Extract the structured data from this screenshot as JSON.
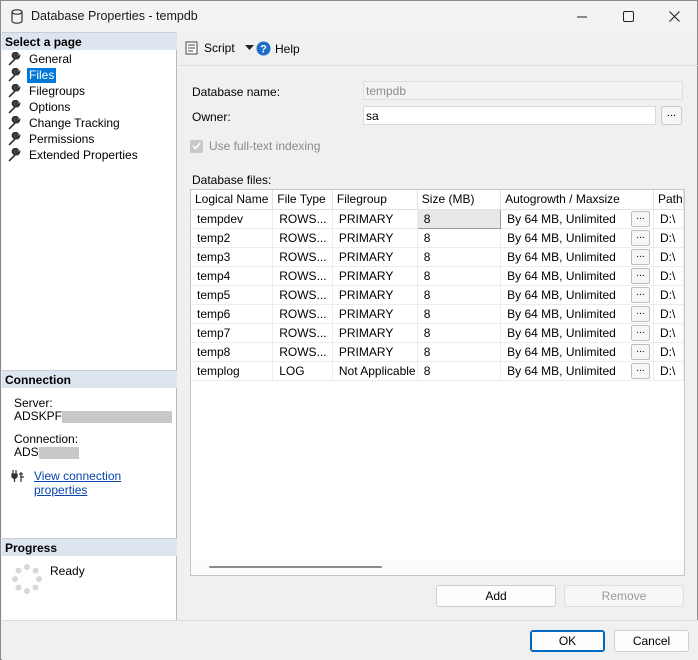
{
  "window": {
    "title": "Database Properties - tempdb"
  },
  "left_panel": {
    "select_page_header": "Select a page",
    "pages": [
      {
        "label": "General",
        "selected": false
      },
      {
        "label": "Files",
        "selected": true
      },
      {
        "label": "Filegroups",
        "selected": false
      },
      {
        "label": "Options",
        "selected": false
      },
      {
        "label": "Change Tracking",
        "selected": false
      },
      {
        "label": "Permissions",
        "selected": false
      },
      {
        "label": "Extended Properties",
        "selected": false
      }
    ],
    "connection_header": "Connection",
    "server_label": "Server:",
    "server_value": "ADSKPF",
    "connection_label": "Connection:",
    "connection_value": "ADS",
    "view_connection_link": "View connection properties",
    "progress_header": "Progress",
    "progress_status": "Ready"
  },
  "toolbar": {
    "script_label": "Script",
    "help_label": "Help"
  },
  "form": {
    "database_name_label": "Database name:",
    "database_name_value": "tempdb",
    "owner_label": "Owner:",
    "owner_value": "sa",
    "ellipsis": "...",
    "fulltext_label": "Use full-text indexing",
    "fulltext_checked": true,
    "database_files_label": "Database files:"
  },
  "grid": {
    "columns": [
      "Logical Name",
      "File Type",
      "Filegroup",
      "Size (MB)",
      "Autogrowth / Maxsize",
      "Path"
    ],
    "rows": [
      {
        "name": "tempdev",
        "type": "ROWS...",
        "filegroup": "PRIMARY",
        "size": "8",
        "autogrowth": "By 64 MB, Unlimited",
        "path": "D:\\"
      },
      {
        "name": "temp2",
        "type": "ROWS...",
        "filegroup": "PRIMARY",
        "size": "8",
        "autogrowth": "By 64 MB, Unlimited",
        "path": "D:\\"
      },
      {
        "name": "temp3",
        "type": "ROWS...",
        "filegroup": "PRIMARY",
        "size": "8",
        "autogrowth": "By 64 MB, Unlimited",
        "path": "D:\\"
      },
      {
        "name": "temp4",
        "type": "ROWS...",
        "filegroup": "PRIMARY",
        "size": "8",
        "autogrowth": "By 64 MB, Unlimited",
        "path": "D:\\"
      },
      {
        "name": "temp5",
        "type": "ROWS...",
        "filegroup": "PRIMARY",
        "size": "8",
        "autogrowth": "By 64 MB, Unlimited",
        "path": "D:\\"
      },
      {
        "name": "temp6",
        "type": "ROWS...",
        "filegroup": "PRIMARY",
        "size": "8",
        "autogrowth": "By 64 MB, Unlimited",
        "path": "D:\\"
      },
      {
        "name": "temp7",
        "type": "ROWS...",
        "filegroup": "PRIMARY",
        "size": "8",
        "autogrowth": "By 64 MB, Unlimited",
        "path": "D:\\"
      },
      {
        "name": "temp8",
        "type": "ROWS...",
        "filegroup": "PRIMARY",
        "size": "8",
        "autogrowth": "By 64 MB, Unlimited",
        "path": "D:\\"
      },
      {
        "name": "templog",
        "type": "LOG",
        "filegroup": "Not Applicable",
        "size": "8",
        "autogrowth": "By 64 MB, Unlimited",
        "path": "D:\\"
      }
    ]
  },
  "buttons": {
    "add": "Add",
    "remove": "Remove",
    "ok": "OK",
    "cancel": "Cancel"
  },
  "colors": {
    "selection": "#0078d7",
    "link": "#0645ad",
    "section_header": "#dde5ef"
  }
}
